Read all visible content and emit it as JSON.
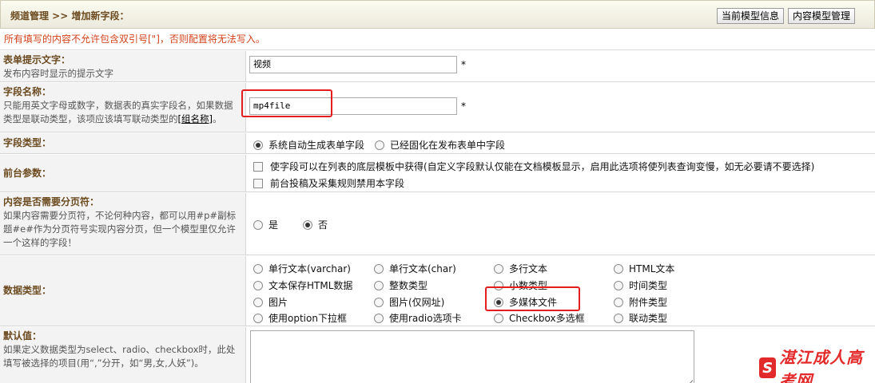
{
  "header": {
    "breadcrumb": "频道管理 >> 增加新字段：",
    "btn_model_info": "当前模型信息",
    "btn_model_manage": "内容模型管理"
  },
  "warning": "所有填写的内容不允许包含双引号[\"]，否则配置将无法写入。",
  "form_tip": {
    "title": "表单提示文字：",
    "desc": "发布内容时显示的提示文字",
    "value": "视频",
    "required": "*"
  },
  "field_name": {
    "title": "字段名称：",
    "desc_1": "只能用英文字母或数字，数据表的真实字段名，如果数据",
    "desc_2": "类型是联动类型，该项应该填写联动类型的",
    "desc_link": "[组名称]",
    "desc_end": "。",
    "value": "mp4file",
    "required": "*"
  },
  "field_type": {
    "title": "字段类型：",
    "options": [
      "系统自动生成表单字段",
      "已经固化在发布表单中字段"
    ],
    "selected": 0
  },
  "front_params": {
    "title": "前台参数：",
    "options": [
      "使字段可以在列表的底层模板中获得(自定义字段默认仅能在文档模板显示，启用此选项将使列表查询变慢，如无必要请不要选择)",
      "前台投稿及采集规则禁用本字段"
    ]
  },
  "paging": {
    "title": "内容是否需要分页符：",
    "desc": "如果内容需要分页符，不论何种内容，都可以用#p#副标题#e#作为分页符号实现内容分页，但一个模型里仅允许一个这样的字段！",
    "options": [
      "是",
      "否"
    ],
    "selected": 1
  },
  "data_type": {
    "title": "数据类型：",
    "options": [
      "单行文本(varchar)",
      "单行文本(char)",
      "多行文本",
      "HTML文本",
      "文本保存HTML数据",
      "整数类型",
      "小数类型",
      "时间类型",
      "图片",
      "图片(仅网址)",
      "多媒体文件",
      "附件类型",
      "使用option下拉框",
      "使用radio选项卡",
      "Checkbox多选框",
      "联动类型"
    ],
    "selected": 10
  },
  "default_value": {
    "title": "默认值：",
    "desc": "如果定义数据类型为select、radio、checkbox时，此处填写被选择的项目(用“,”分开，如“男,女,人妖”)。",
    "value": ""
  },
  "watermark": "湛江成人高考网",
  "colors": {
    "label_text": "#6b4a1f",
    "warning": "#d0421b",
    "highlight": "#e41e1e"
  }
}
